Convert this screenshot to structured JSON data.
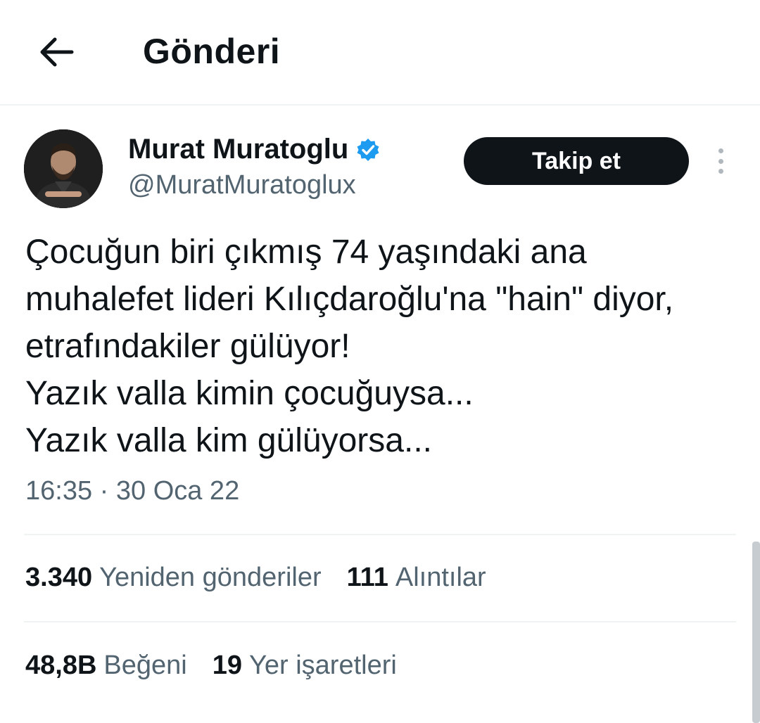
{
  "header": {
    "title": "Gönderi",
    "back_icon": "arrow-left-icon"
  },
  "author": {
    "display_name": "Murat Muratoglu",
    "handle": "@MuratMuratoglux",
    "verified_icon": "verified-badge-icon",
    "verified_color": "#1d9bf0"
  },
  "actions": {
    "follow_label": "Takip et",
    "more_icon": "more-vertical-icon"
  },
  "tweet": {
    "lines": [
      "Çocuğun biri çıkmış 74 yaşındaki ana",
      "muhalefet lideri Kılıçdaroğlu'na \"hain\" diyor,",
      "etrafındakiler gülüyor!",
      "Yazık valla kimin çocuğuysa...",
      "Yazık valla kim gülüyorsa..."
    ],
    "timestamp": "16:35 · 30 Oca 22"
  },
  "stats": {
    "retweets": {
      "count": "3.340",
      "label": "Yeniden gönderiler"
    },
    "quotes": {
      "count": "111",
      "label": "Alıntılar"
    },
    "likes": {
      "count": "48,8B",
      "label": "Beğeni"
    },
    "bookmarks": {
      "count": "19",
      "label": "Yer işaretleri"
    }
  }
}
